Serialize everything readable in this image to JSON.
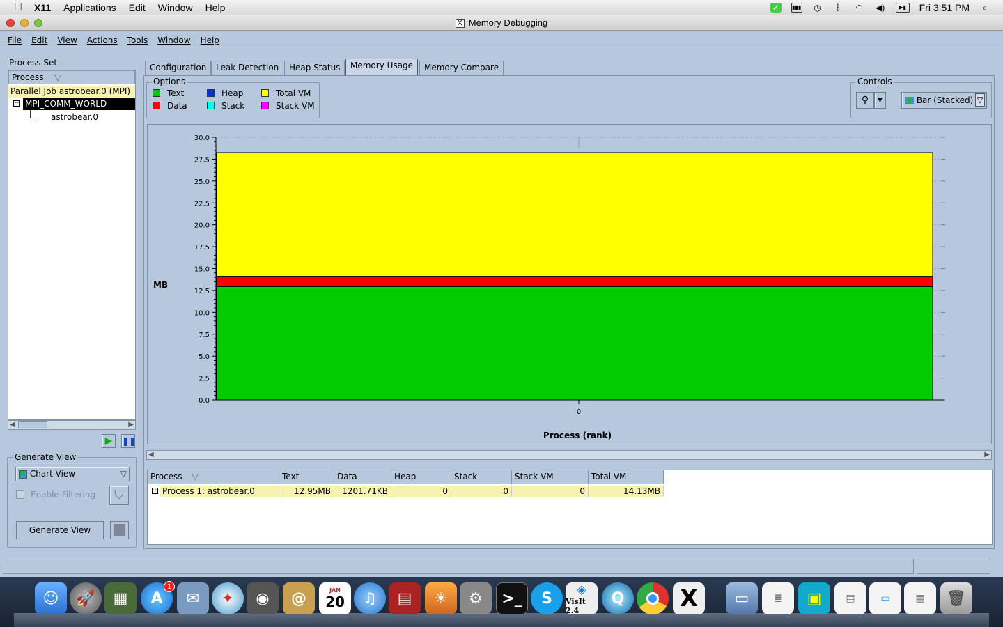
{
  "macbar": {
    "app": "X11",
    "menus": [
      "Applications",
      "Edit",
      "Window",
      "Help"
    ],
    "clock": "Fri 3:51 PM"
  },
  "window": {
    "title": "Memory Debugging"
  },
  "menu": [
    "File",
    "Edit",
    "View",
    "Actions",
    "Tools",
    "Window",
    "Help"
  ],
  "process_set": {
    "label": "Process Set",
    "column": "Process",
    "job": "Parallel Job astrobear.0 (MPI)",
    "comm": "MPI_COMM_WORLD",
    "rank": "astrobear.0"
  },
  "generate_view": {
    "label": "Generate View",
    "view_select": "Chart View",
    "filter_label": "Enable Filtering",
    "button": "Generate View"
  },
  "tabs": [
    "Configuration",
    "Leak Detection",
    "Heap Status",
    "Memory Usage",
    "Memory Compare"
  ],
  "active_tab": "Memory Usage",
  "options": {
    "label": "Options",
    "items": [
      {
        "name": "Text",
        "color": "#00cc00"
      },
      {
        "name": "Data",
        "color": "#ff0000"
      },
      {
        "name": "Heap",
        "color": "#0033cc"
      },
      {
        "name": "Stack",
        "color": "#00ffff"
      },
      {
        "name": "Total VM",
        "color": "#ffff00"
      },
      {
        "name": "Stack VM",
        "color": "#ff00ff"
      }
    ]
  },
  "controls": {
    "label": "Controls",
    "chart_type": "Bar (Stacked)"
  },
  "chart_data": {
    "type": "bar",
    "categories": [
      "0"
    ],
    "series": [
      {
        "name": "Text",
        "values": [
          12.95
        ],
        "color": "#00cc00"
      },
      {
        "name": "Data",
        "values": [
          1.17
        ],
        "color": "#ff0000"
      },
      {
        "name": "Total VM",
        "values": [
          14.13
        ],
        "color": "#ffff00"
      }
    ],
    "xlabel": "Process (rank)",
    "ylabel": "MB",
    "ylim": [
      0,
      30
    ],
    "yticks": [
      "0.0",
      "2.5",
      "5.0",
      "7.5",
      "10.0",
      "12.5",
      "15.0",
      "17.5",
      "20.0",
      "22.5",
      "25.0",
      "27.5",
      "30.0"
    ],
    "grid": true,
    "stacked": true
  },
  "table": {
    "columns": [
      "Process",
      "Text",
      "Data",
      "Heap",
      "Stack",
      "Stack VM",
      "Total VM"
    ],
    "rows": [
      [
        "Process 1: astrobear.0",
        "12.95MB",
        "1201.71KB",
        "0",
        "0",
        "0",
        "14.13MB"
      ]
    ]
  },
  "dock": [
    "Finder",
    "Launchpad",
    "Preview",
    "App Store",
    "Mail",
    "Safari",
    "FaceTime",
    "Contacts",
    "Calendar",
    "iTunes",
    "Photo Booth",
    "iPhoto",
    "System Preferences",
    "Terminal",
    "Skype",
    "VisIt 2.4",
    "QuickTime",
    "Chrome",
    "X11",
    "Folder",
    "Document",
    "Image",
    "Window",
    "Window",
    "Window",
    "Trash"
  ],
  "dock_visit_label": "VisIt 2.4",
  "calendar_day": "20",
  "calendar_month": "JAN",
  "badge_count": "1"
}
